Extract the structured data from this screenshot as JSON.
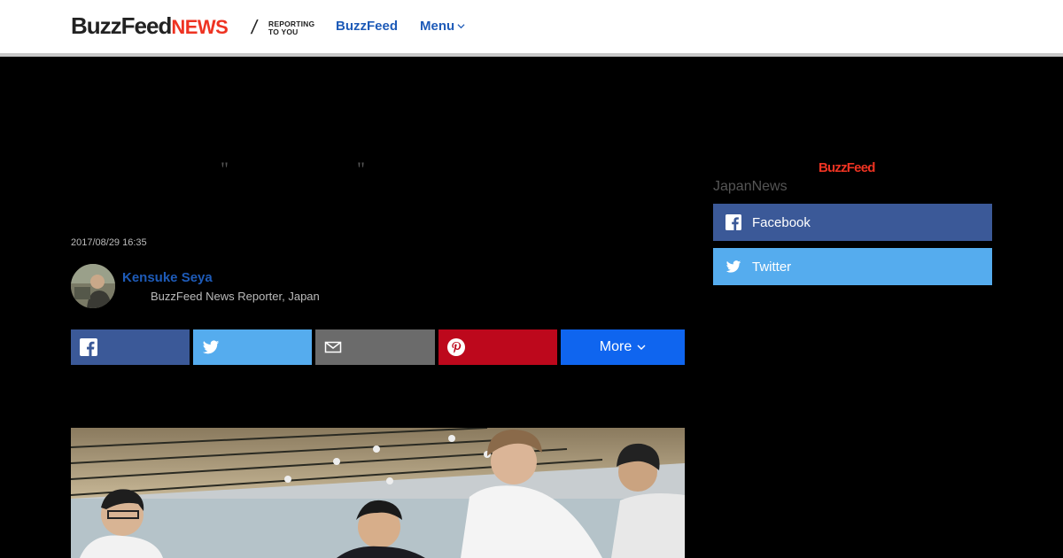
{
  "header": {
    "logo_main": "BuzzFeed",
    "logo_news": "NEWS",
    "slash": "/",
    "tagline_line1": "REPORTING",
    "tagline_line2": "TO YOU",
    "nav_buzzfeed": "BuzzFeed",
    "nav_menu": "Menu"
  },
  "article": {
    "quote_open": "\"",
    "quote_close": "\"",
    "date": "2017/08/29 16:35",
    "author_name": "Kensuke Seya",
    "author_title": "BuzzFeed News Reporter, Japan",
    "share_more_label": "More"
  },
  "sidebar": {
    "logo": "BuzzFeed",
    "label": "JapanNews",
    "facebook_label": "Facebook",
    "twitter_label": "Twitter"
  },
  "colors": {
    "brand_red": "#e32",
    "link_blue": "#1e5bb8",
    "facebook": "#3b5998",
    "twitter": "#55acee",
    "email": "#6b6b6b",
    "pinterest": "#bd081c",
    "more": "#0f65ef"
  },
  "icons": {
    "facebook": "facebook-icon",
    "twitter": "twitter-icon",
    "email": "envelope-icon",
    "pinterest": "pinterest-icon",
    "chevron": "chevron-down-icon"
  }
}
